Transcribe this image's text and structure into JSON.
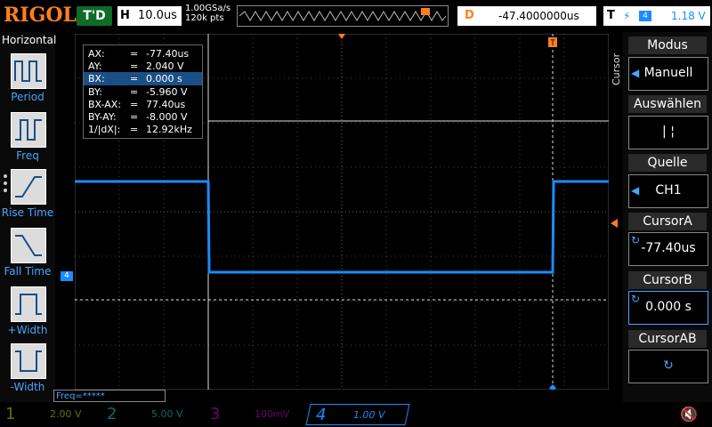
{
  "header": {
    "logo": "RIGOL",
    "trigger_state": "T'D",
    "h_label": "H",
    "timebase": "10.0us",
    "sample_rate": "1.00GSa/s",
    "mem_depth": "120k pts",
    "delay_label": "D",
    "delay_value": "-47.4000000us",
    "trig_label": "T",
    "trig_channel": "4",
    "trig_level": "1.18 V"
  },
  "left_menu": {
    "title": "Horizontal",
    "items": [
      {
        "label": "Period",
        "icon": "period-icon"
      },
      {
        "label": "Freq",
        "icon": "freq-icon"
      },
      {
        "label": "Rise Time",
        "icon": "rise-time-icon"
      },
      {
        "label": "Fall Time",
        "icon": "fall-time-icon"
      },
      {
        "label": "+Width",
        "icon": "pos-width-icon"
      },
      {
        "label": "-Width",
        "icon": "neg-width-icon"
      }
    ]
  },
  "measurements": [
    {
      "key": "AX:",
      "value": "-77.40us"
    },
    {
      "key": "AY:",
      "value": "2.040 V"
    },
    {
      "key": "BX:",
      "value": "0.000 s"
    },
    {
      "key": "BY:",
      "value": "-5.960 V"
    },
    {
      "key": "BX-AX:",
      "value": "77.40us"
    },
    {
      "key": "BY-AY:",
      "value": "-8.000 V"
    },
    {
      "key": "1/|dX|:",
      "value": "12.92kHz"
    }
  ],
  "measurement_eq": "=",
  "right_menu": {
    "vertical_title": "Cursor",
    "modus_title": "Modus",
    "modus_value": "Manuell",
    "auswahlen_title": "Auswählen",
    "auswahlen_value": "|   ¦",
    "quelle_title": "Quelle",
    "quelle_value": "CH1",
    "cursora_title": "CursorA",
    "cursora_value": "-77.40us",
    "cursorb_title": "CursorB",
    "cursorb_value": "0.000 s",
    "cursorab_title": "CursorAB"
  },
  "channels": [
    {
      "num": "1",
      "value": "2.00 V",
      "color": "#e8e800"
    },
    {
      "num": "2",
      "value": "5.00 V",
      "color": "#00e0e0"
    },
    {
      "num": "3",
      "value": "100mV",
      "color": "#e000e0"
    },
    {
      "num": "4",
      "value": "1.00 V",
      "color": "#1a8cff"
    }
  ],
  "freq_counter": "Freq=*****",
  "ch4_marker": "4",
  "trigger_marker": "T",
  "colors": {
    "trace": "#1a8cff",
    "accent": "#ff7f1e",
    "trig_green": "#0f6b28"
  }
}
